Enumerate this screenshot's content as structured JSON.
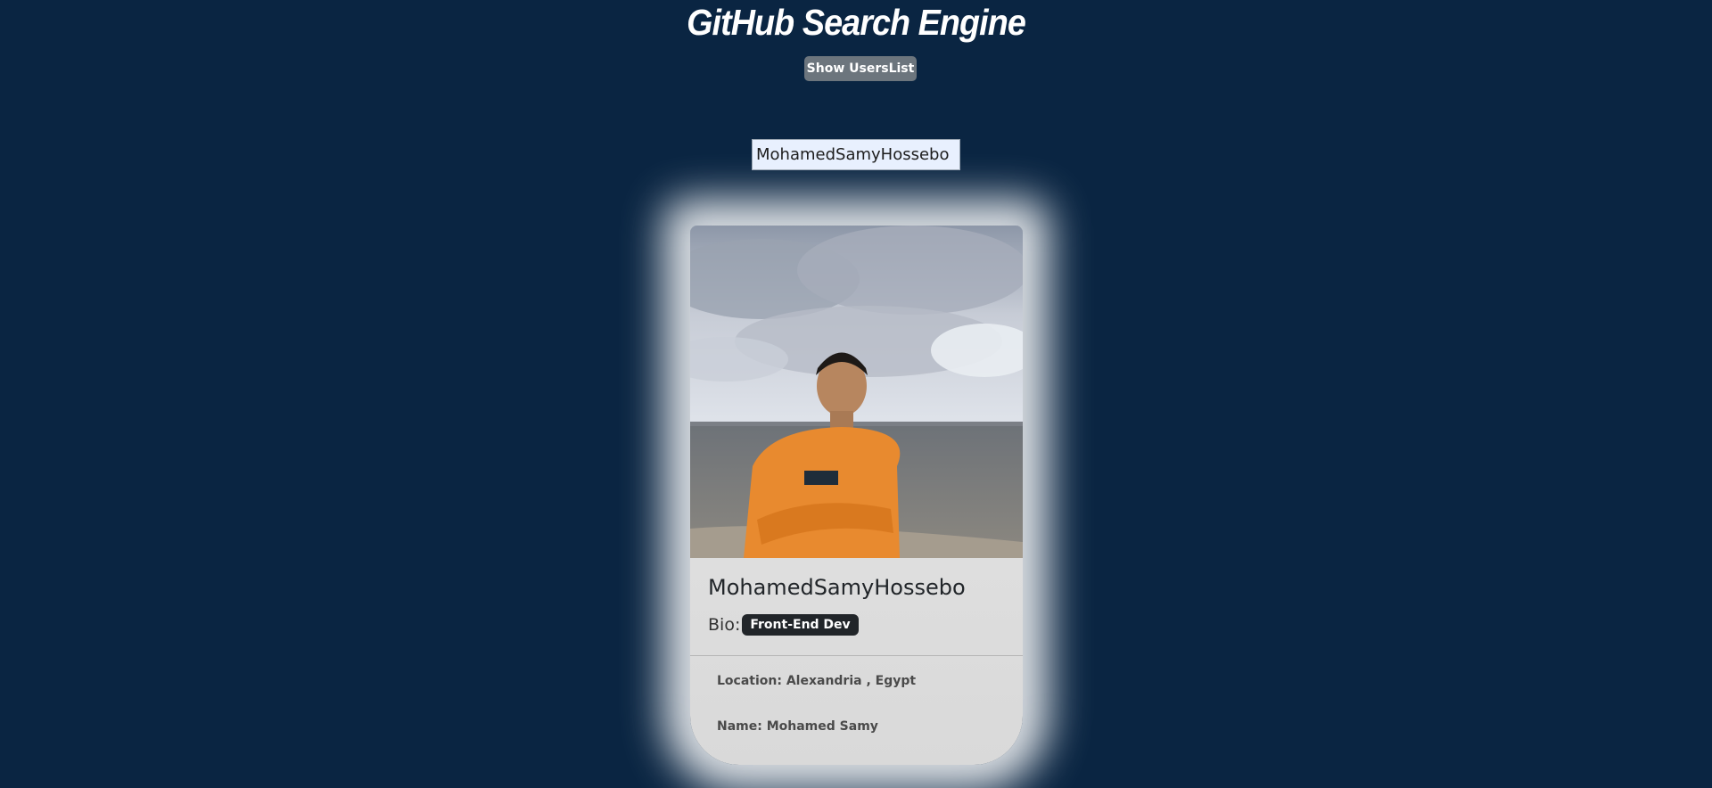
{
  "header": {
    "title": "GitHub Search Engine",
    "show_users_label": "Show UsersList"
  },
  "search": {
    "value": "MohamedSamyHossebo"
  },
  "profile": {
    "username": "MohamedSamyHossebo",
    "bio_label": "Bio:",
    "bio_badge": "Front-End Dev",
    "location": "Location: Alexandria , Egypt",
    "name": "Name: Mohamed Samy"
  },
  "colors": {
    "background": "#0a2542",
    "button": "#6c757d",
    "badge": "#212529"
  }
}
